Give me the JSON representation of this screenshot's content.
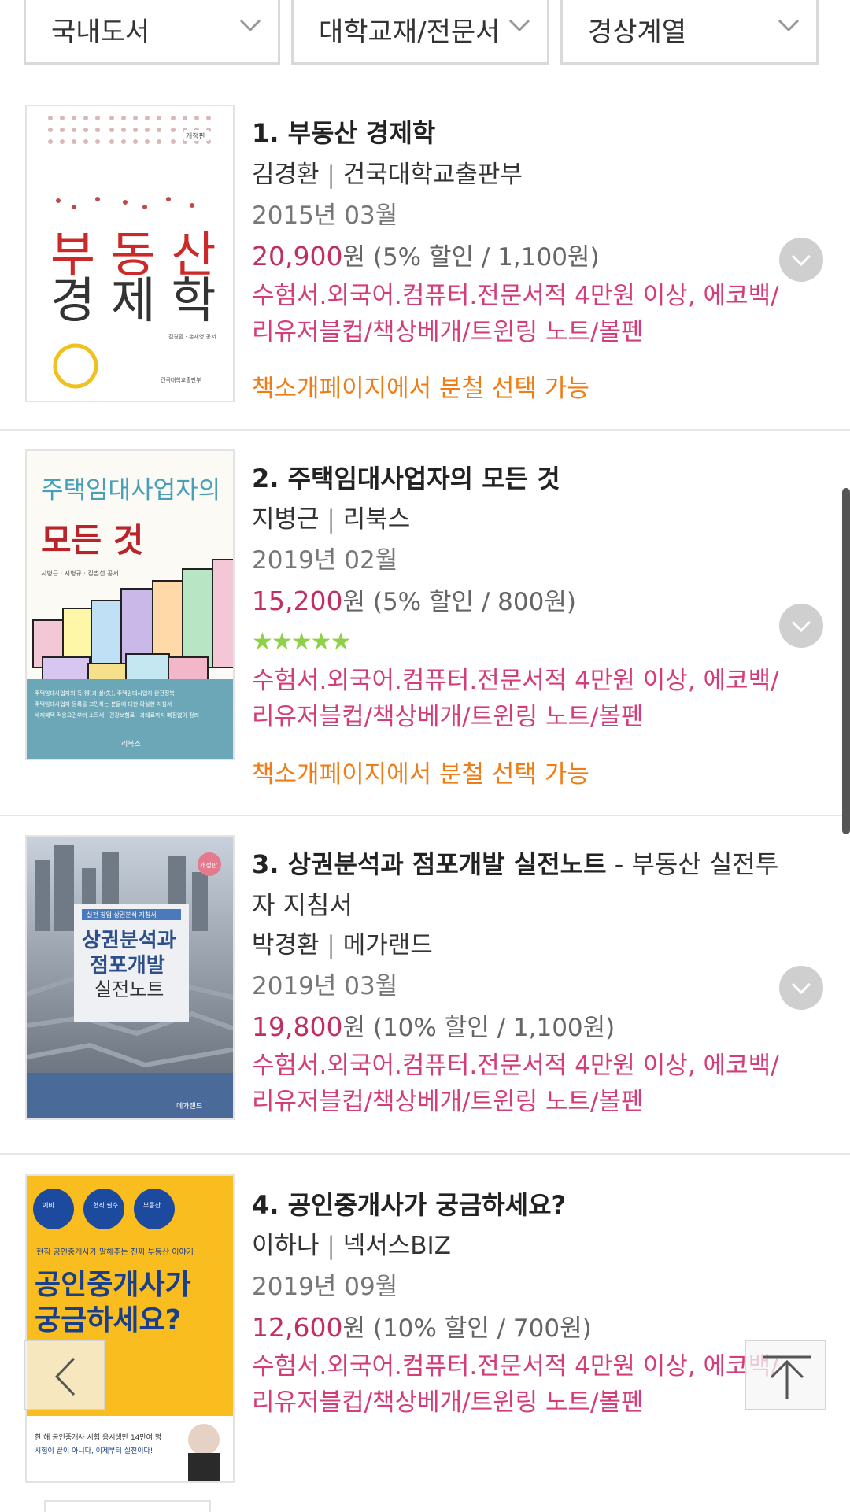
{
  "filters": [
    {
      "label": "국내도서"
    },
    {
      "label": "대학교재/전문서적"
    },
    {
      "label": "경상계열"
    }
  ],
  "books": [
    {
      "rank_title": "1. 부동산 경제학",
      "subtitle": "",
      "author": "김경환",
      "publisher": "건국대학교출판부",
      "date": "2015년 03월",
      "price": "20,900",
      "price_unit": "원",
      "discount": " (5% 할인 / 1,100원)",
      "promo": "수험서.외국어.컴퓨터.전문서적 4만원 이상, 에코백/리유저블컵/책상베개/트윈링 노트/볼펜",
      "split": "책소개페이지에서 분철 선택 가능",
      "cover": {
        "title_line1": "부 동 산",
        "title_line2": "경 제 학",
        "badge": "개정판",
        "author_small": "김경환 · 손재영 공저",
        "publisher_small": "건국대학교출판부"
      }
    },
    {
      "rank_title": "2. 주택임대사업자의 모든 것",
      "subtitle": "",
      "author": "지병근",
      "publisher": "리북스",
      "date": "2019년 02월",
      "price": "15,200",
      "price_unit": "원",
      "discount": " (5% 할인 / 800원)",
      "stars": "★★★★★",
      "promo": "수험서.외국어.컴퓨터.전문서적 4만원 이상, 에코백/리유저블컵/책상베개/트윈링 노트/볼펜",
      "split": "책소개페이지에서 분철 선택 가능",
      "cover": {
        "title_line1": "주택임대사업자의",
        "title_line2": "모든 것",
        "author_small": "지병근 · 지병규 · 김범선 공저",
        "publisher_small": "리북스"
      }
    },
    {
      "rank_title": "3. 상권분석과 점포개발 실전노트",
      "subtitle": " - 부동산 실전투자 지침서",
      "author": "박경환",
      "publisher": "메가랜드",
      "date": "2019년 03월",
      "price": "19,800",
      "price_unit": "원",
      "discount": " (10% 할인 / 1,100원)",
      "promo": "수험서.외국어.컴퓨터.전문서적 4만원 이상, 에코백/리유저블컵/책상베개/트윈링 노트/볼펜",
      "cover": {
        "badge": "개정판",
        "tag": "실전 창업 상권분석 지침서",
        "title_line1": "상권분석과",
        "title_line2": "점포개발",
        "title_line3": "실전노트",
        "publisher_small": "메가랜드"
      }
    },
    {
      "rank_title": "4. 공인중개사가 궁금하세요?",
      "subtitle": "",
      "author": "이하나",
      "publisher": "넥서스BIZ",
      "date": "2019년 09월",
      "price": "12,600",
      "price_unit": "원",
      "discount": " (10% 할인 / 700원)",
      "promo": "수험서.외국어.컴퓨터.전문서적 4만원 이상, 에코백/리유저블컵/책상베개/트윈링 노트/볼펜",
      "cover": {
        "tagline": "현직 공인중개사가 말해주는 진짜 부동산 이야기",
        "title_line1": "공인중개사가",
        "title_line2": "궁금하세요?",
        "bottom1": "한 해 공인중개사 시험 응시생만 14만여 명",
        "bottom2": "시험이 끝이 아니다, 이제부터 실전이다!"
      }
    }
  ],
  "nav": {
    "back_icon": "chevron-left-icon",
    "top_icon": "arrow-up-icon"
  }
}
